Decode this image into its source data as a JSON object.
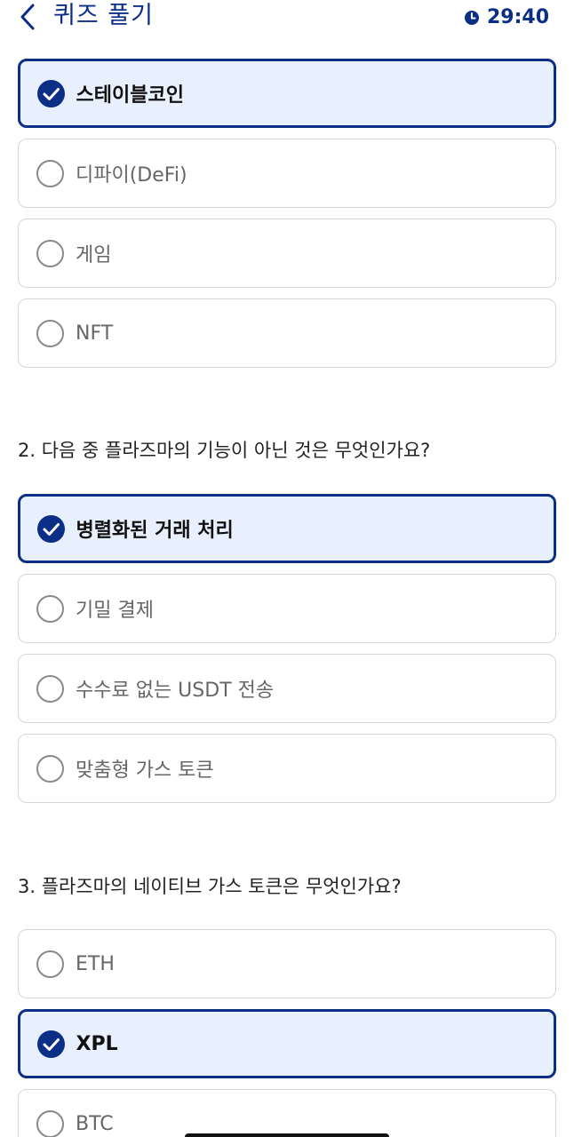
{
  "header": {
    "title": "퀴즈 풀기",
    "timer": "29:40",
    "back_icon": "chevron-left-icon",
    "timer_icon": "clock-icon"
  },
  "colors": {
    "accent": "#0b2f87",
    "selected_bg": "#e9f0fd",
    "border": "#d6d6d6"
  },
  "q1": {
    "options": [
      {
        "label": "스테이블코인",
        "selected": true
      },
      {
        "label": "디파이(DeFi)",
        "selected": false
      },
      {
        "label": "게임",
        "selected": false
      },
      {
        "label": "NFT",
        "selected": false
      }
    ]
  },
  "q2": {
    "question": "2. 다음 중 플라즈마의 기능이 아닌 것은 무엇인가요?",
    "options": [
      {
        "label": "병렬화된 거래 처리",
        "selected": true
      },
      {
        "label": "기밀 결제",
        "selected": false
      },
      {
        "label": "수수료 없는 USDT 전송",
        "selected": false
      },
      {
        "label": "맞춤형 가스 토큰",
        "selected": false
      }
    ]
  },
  "q3": {
    "question": "3. 플라즈마의 네이티브 가스 토큰은 무엇인가요?",
    "options": [
      {
        "label": "ETH",
        "selected": false
      },
      {
        "label": "XPL",
        "selected": true
      },
      {
        "label": "BTC",
        "selected": false
      }
    ]
  }
}
